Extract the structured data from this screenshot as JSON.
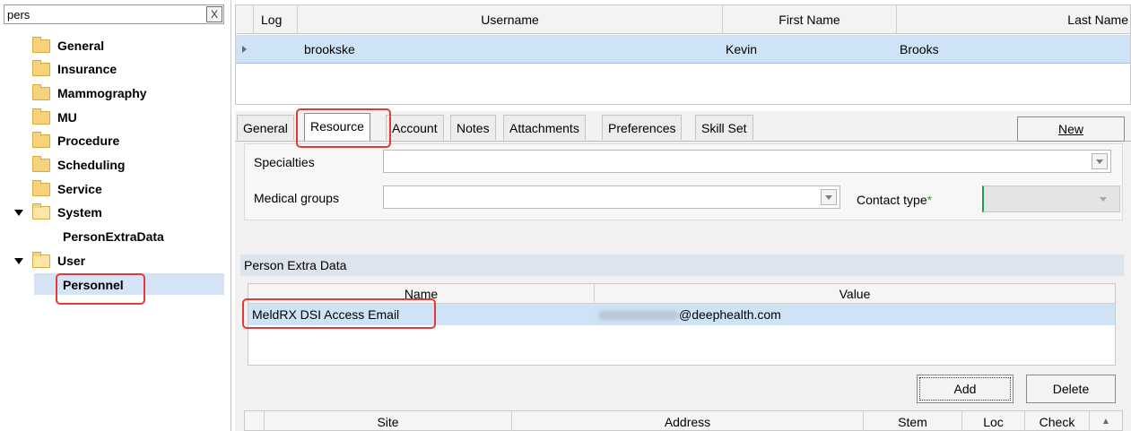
{
  "search": {
    "value": "pers",
    "clear_label": "X"
  },
  "tree": {
    "items": [
      "General",
      "Insurance",
      "Mammography",
      "MU",
      "Procedure",
      "Scheduling",
      "Service"
    ],
    "system": {
      "label": "System",
      "child": "PersonExtraData"
    },
    "user": {
      "label": "User",
      "child": "Personnel"
    }
  },
  "grid": {
    "headers": [
      "Log",
      "Username",
      "First Name",
      "Last Name"
    ],
    "row": {
      "username": "brookske",
      "first_name": "Kevin",
      "last_name": "Brooks"
    }
  },
  "tabs": [
    "General",
    "Resource",
    "Account",
    "Notes",
    "Attachments",
    "Preferences",
    "Skill Set"
  ],
  "active_tab": "Resource",
  "new_button": "New",
  "form": {
    "specialties_label": "Specialties",
    "medical_groups_label": "Medical groups",
    "contact_type_label": "Contact type",
    "required_mark": "*"
  },
  "person_extra": {
    "title": "Person Extra Data",
    "headers": [
      "Name",
      "Value"
    ],
    "row": {
      "name": "MeldRX DSI Access Email",
      "value_suffix": "@deephealth.com"
    }
  },
  "buttons": {
    "add": "Add",
    "delete": "Delete"
  },
  "bottom_grid_headers": [
    "Site",
    "Address",
    "Stem",
    "Loc",
    "Check"
  ],
  "colors": {
    "selection": "#cfe3f6",
    "highlight": "#e23a3a",
    "required": "#22a046",
    "folder": "#f6d37a"
  }
}
